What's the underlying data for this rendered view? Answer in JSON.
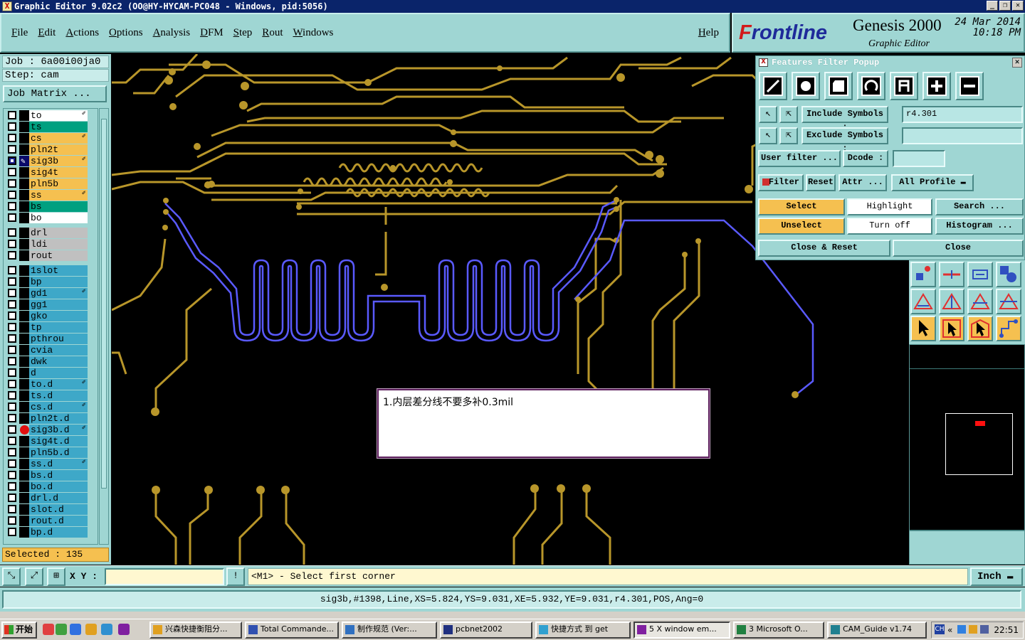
{
  "window": {
    "title": "Graphic Editor 9.02c2 (OO@HY-HYCAM-PC048 - Windows, pid:5056)"
  },
  "menu": {
    "items": [
      "File",
      "Edit",
      "Actions",
      "Options",
      "Analysis",
      "DFM",
      "Step",
      "Rout",
      "Windows"
    ],
    "help": "Help"
  },
  "brand": {
    "logo_f": "F",
    "logo_rest": "rontline",
    "product": "Genesis 2000",
    "subtitle": "Graphic Editor",
    "date": "24 Mar 2014",
    "time": "10:18 PM"
  },
  "left_panel": {
    "job": "Job : 6a00i00ja0",
    "step": "Step: cam",
    "job_matrix": "Job Matrix ...",
    "selected": "Selected : 135"
  },
  "layers": [
    {
      "name": "to",
      "color": "#ffffff",
      "arrow": true
    },
    {
      "name": "ts",
      "color": "#00a080",
      "arrow": false
    },
    {
      "name": "cs",
      "color": "#f5c050",
      "arrow": true
    },
    {
      "name": "pln2t",
      "color": "#f5c050",
      "arrow": false
    },
    {
      "name": "sig3b",
      "color": "#f5c050",
      "arrow": true,
      "work": true
    },
    {
      "name": "sig4t",
      "color": "#f5c050",
      "arrow": false
    },
    {
      "name": "pln5b",
      "color": "#f5c050",
      "arrow": false
    },
    {
      "name": "ss",
      "color": "#f5c050",
      "arrow": true
    },
    {
      "name": "bs",
      "color": "#00a080",
      "arrow": false
    },
    {
      "name": "bo",
      "color": "#ffffff",
      "arrow": false
    },
    {
      "name": "drl",
      "color": "#c0c0c0",
      "arrow": false,
      "gap": true
    },
    {
      "name": "ldi",
      "color": "#c0c0c0",
      "arrow": false
    },
    {
      "name": "rout",
      "color": "#c0c0c0",
      "arrow": false
    },
    {
      "name": "1slot",
      "color": "#3ea8c8",
      "arrow": false,
      "gap": true
    },
    {
      "name": "bp",
      "color": "#3ea8c8",
      "arrow": false
    },
    {
      "name": "gd1",
      "color": "#3ea8c8",
      "arrow": true
    },
    {
      "name": "gg1",
      "color": "#3ea8c8",
      "arrow": false
    },
    {
      "name": "gko",
      "color": "#3ea8c8",
      "arrow": false
    },
    {
      "name": "tp",
      "color": "#3ea8c8",
      "arrow": false
    },
    {
      "name": "pthrou",
      "color": "#3ea8c8",
      "arrow": false
    },
    {
      "name": "cvia",
      "color": "#3ea8c8",
      "arrow": false
    },
    {
      "name": "dwk",
      "color": "#3ea8c8",
      "arrow": false
    },
    {
      "name": "d",
      "color": "#3ea8c8",
      "arrow": false
    },
    {
      "name": "to.d",
      "color": "#3ea8c8",
      "arrow": true
    },
    {
      "name": "ts.d",
      "color": "#3ea8c8",
      "arrow": false
    },
    {
      "name": "cs.d",
      "color": "#3ea8c8",
      "arrow": true
    },
    {
      "name": "pln2t.d",
      "color": "#3ea8c8",
      "arrow": false
    },
    {
      "name": "sig3b.d",
      "color": "#3ea8c8",
      "arrow": true,
      "dot": true
    },
    {
      "name": "sig4t.d",
      "color": "#3ea8c8",
      "arrow": false
    },
    {
      "name": "pln5b.d",
      "color": "#3ea8c8",
      "arrow": false
    },
    {
      "name": "ss.d",
      "color": "#3ea8c8",
      "arrow": true
    },
    {
      "name": "bs.d",
      "color": "#3ea8c8",
      "arrow": false
    },
    {
      "name": "bo.d",
      "color": "#3ea8c8",
      "arrow": false
    },
    {
      "name": "drl.d",
      "color": "#3ea8c8",
      "arrow": false
    },
    {
      "name": "slot.d",
      "color": "#3ea8c8",
      "arrow": false
    },
    {
      "name": "rout.d",
      "color": "#3ea8c8",
      "arrow": false
    },
    {
      "name": "bp.d",
      "color": "#3ea8c8",
      "arrow": false
    }
  ],
  "note": {
    "text": "1.内层差分线不要多补0.3mil"
  },
  "filter_popup": {
    "title": "Features Filter Popup",
    "include_symbols_label": "Include Symbols :",
    "include_symbols_value": "r4.301",
    "exclude_symbols_label": "Exclude Symbols :",
    "exclude_symbols_value": "",
    "user_filter": "User filter ...",
    "dcode_label": "Dcode :",
    "dcode_value": "",
    "filter": "Filter",
    "reset": "Reset",
    "attr": "Attr ...",
    "profile": "All Profile",
    "select": "Select",
    "highlight": "Highlight",
    "search": "Search ...",
    "unselect": "Unselect",
    "turn_off": "Turn off",
    "histogram": "Histogram ...",
    "close_reset": "Close & Reset",
    "close": "Close"
  },
  "prompt": {
    "xy_label": "X Y :",
    "xy_value": "",
    "info_button": "!",
    "message": "<M1> - Select first corner",
    "unit": "Inch"
  },
  "status": {
    "feature_info": "sig3b,#1398,Line,XS=5.824,YS=9.031,XE=5.932,YE=9.031,r4.301,POS,Ang=0"
  },
  "taskbar": {
    "start": "开始",
    "tasks": [
      {
        "label": "兴森快捷衡阻分...",
        "icon_color": "#e0a020"
      },
      {
        "label": "Total Commande...",
        "icon_color": "#3050b0"
      },
      {
        "label": "制作规范 (Ver:...",
        "icon_color": "#3070c0"
      },
      {
        "label": "pcbnet2002",
        "icon_color": "#203080"
      },
      {
        "label": "快捷方式 到 get",
        "icon_color": "#30a0d0"
      },
      {
        "label": "5 X window em...",
        "icon_color": "#8020a0",
        "active": true
      },
      {
        "label": "3 Microsoft O...",
        "icon_color": "#208040"
      },
      {
        "label": "CAM_Guide v1.74",
        "icon_color": "#208090"
      }
    ],
    "clock": "22:51"
  },
  "colors": {
    "trace": "#b8962a",
    "selected_trace": "#5a5aff",
    "panel": "#9fd6d3"
  }
}
